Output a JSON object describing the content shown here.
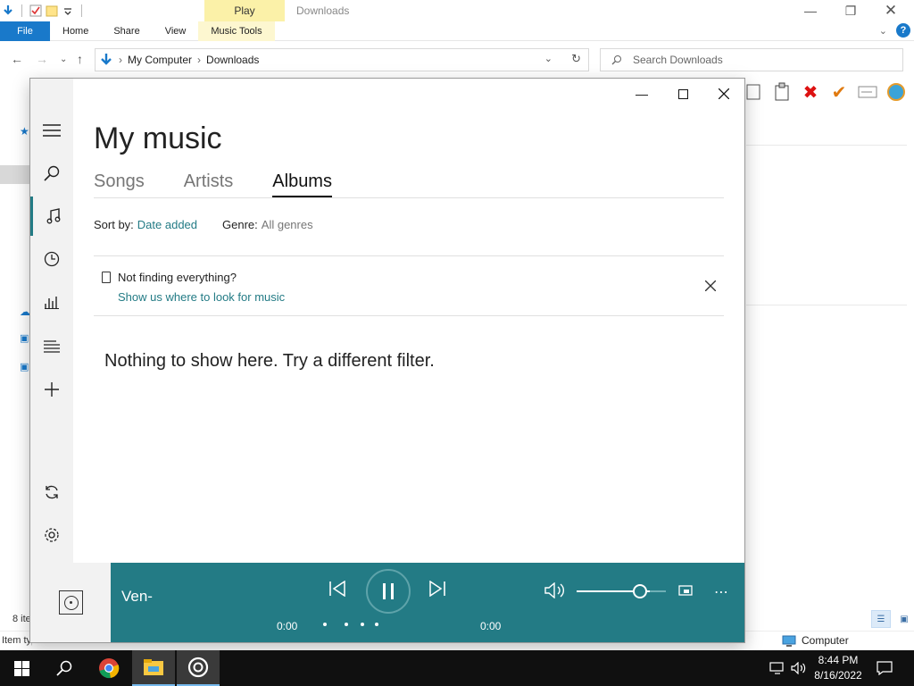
{
  "explorer": {
    "title": "Downloads",
    "contextual_tab_header": "Play",
    "tabs": [
      {
        "label": "File"
      },
      {
        "label": "Home"
      },
      {
        "label": "Share"
      },
      {
        "label": "View"
      },
      {
        "label": "Music Tools"
      }
    ],
    "breadcrumb": [
      "My Computer",
      "Downloads"
    ],
    "search_placeholder": "Search Downloads",
    "status_items": "8 ite",
    "status_item_type": "Item type",
    "status_right": "Computer",
    "colors": {
      "file_tab": "#1979ca",
      "context_tab": "#fbf1a8"
    }
  },
  "groove": {
    "page_title": "My music",
    "tabs": [
      {
        "label": "Songs",
        "selected": false
      },
      {
        "label": "Artists",
        "selected": false
      },
      {
        "label": "Albums",
        "selected": true
      }
    ],
    "sort_label": "Sort by:",
    "sort_value": "Date added",
    "genre_label": "Genre:",
    "genre_value": "All genres",
    "notice_title": "Not finding everything?",
    "notice_link": "Show us where to look for music",
    "empty_message": "Nothing to show here. Try a different filter.",
    "sidebar_icons": [
      "hamburger-icon",
      "search-icon",
      "music-note-icon",
      "recent-clock-icon",
      "now-playing-icon",
      "playlists-icon",
      "add-icon",
      "sync-icon",
      "settings-icon"
    ],
    "player": {
      "track": "Ven-",
      "time_elapsed": "0:00",
      "time_total": "0:00",
      "state": "playing",
      "volume_fraction": 0.72
    },
    "colors": {
      "accent": "#237b85",
      "link": "#237b85"
    }
  },
  "taskbar": {
    "time": "8:44 PM",
    "date": "8/16/2022",
    "pinned": [
      "start-icon",
      "search-icon",
      "chrome-icon",
      "file-explorer-icon",
      "groove-music-icon"
    ]
  }
}
